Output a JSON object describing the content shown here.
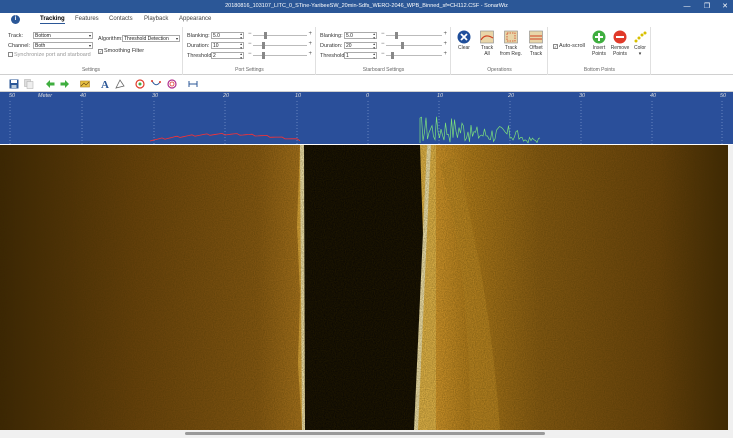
{
  "window": {
    "title": "20180816_103107_LITC_0_STine-YaribeeSW_20min-Sdfs_WERO-2046_WPB_Binned_sf=CH112.CSF - SonarWiz",
    "minimize": "—",
    "maximize": "❐",
    "close": "✕"
  },
  "tabs": [
    "Tracking",
    "Features",
    "Contacts",
    "Playback",
    "Appearance"
  ],
  "settings": {
    "track_label": "Track:",
    "track_value": "Bottom",
    "channel_label": "Channel:",
    "channel_value": "Both",
    "sync_label": "Synchronize port and starboard",
    "algorithm_label": "Algorithm:",
    "algorithm_value": "Threshold Detection",
    "smoothing_label": "Smoothing Filter",
    "caption": "Settings"
  },
  "port": {
    "blanking_label": "Blanking:",
    "blanking_value": "5.0",
    "duration_label": "Duration:",
    "duration_value": "10",
    "threshold_label": "Threshold:",
    "threshold_value": "2",
    "caption": "Port Settings"
  },
  "starboard": {
    "blanking_label": "Blanking:",
    "blanking_value": "5.0",
    "duration_label": "Duration:",
    "duration_value": "20",
    "threshold_label": "Threshold:",
    "threshold_value": "1",
    "caption": "Starboard Settings"
  },
  "operations": {
    "clear": "Clear",
    "track_all_1": "Track",
    "track_all_2": "All",
    "track_reg_1": "Track",
    "track_reg_2": "from Reg.",
    "offset_1": "Offset",
    "offset_2": "Track",
    "caption": "Operations"
  },
  "bottom_points": {
    "autoscroll": "Auto-scroll",
    "insert_1": "Insert",
    "insert_2": "Points",
    "remove_1": "Remove",
    "remove_2": "Points",
    "color_1": "Color",
    "color_2": "▾",
    "caption": "Bottom Points"
  },
  "scale": {
    "unit": "Meter",
    "ticks": [
      "50",
      "40",
      "30",
      "20",
      "10",
      "0",
      "10",
      "20",
      "30",
      "40",
      "50"
    ]
  },
  "colors": {
    "title_bar": "#2b5797",
    "waterfall_bg": "#2a4f9a",
    "sonar_amber": "#c8821a",
    "port_trace": "#ff3030",
    "stbd_trace": "#7ce07c"
  }
}
